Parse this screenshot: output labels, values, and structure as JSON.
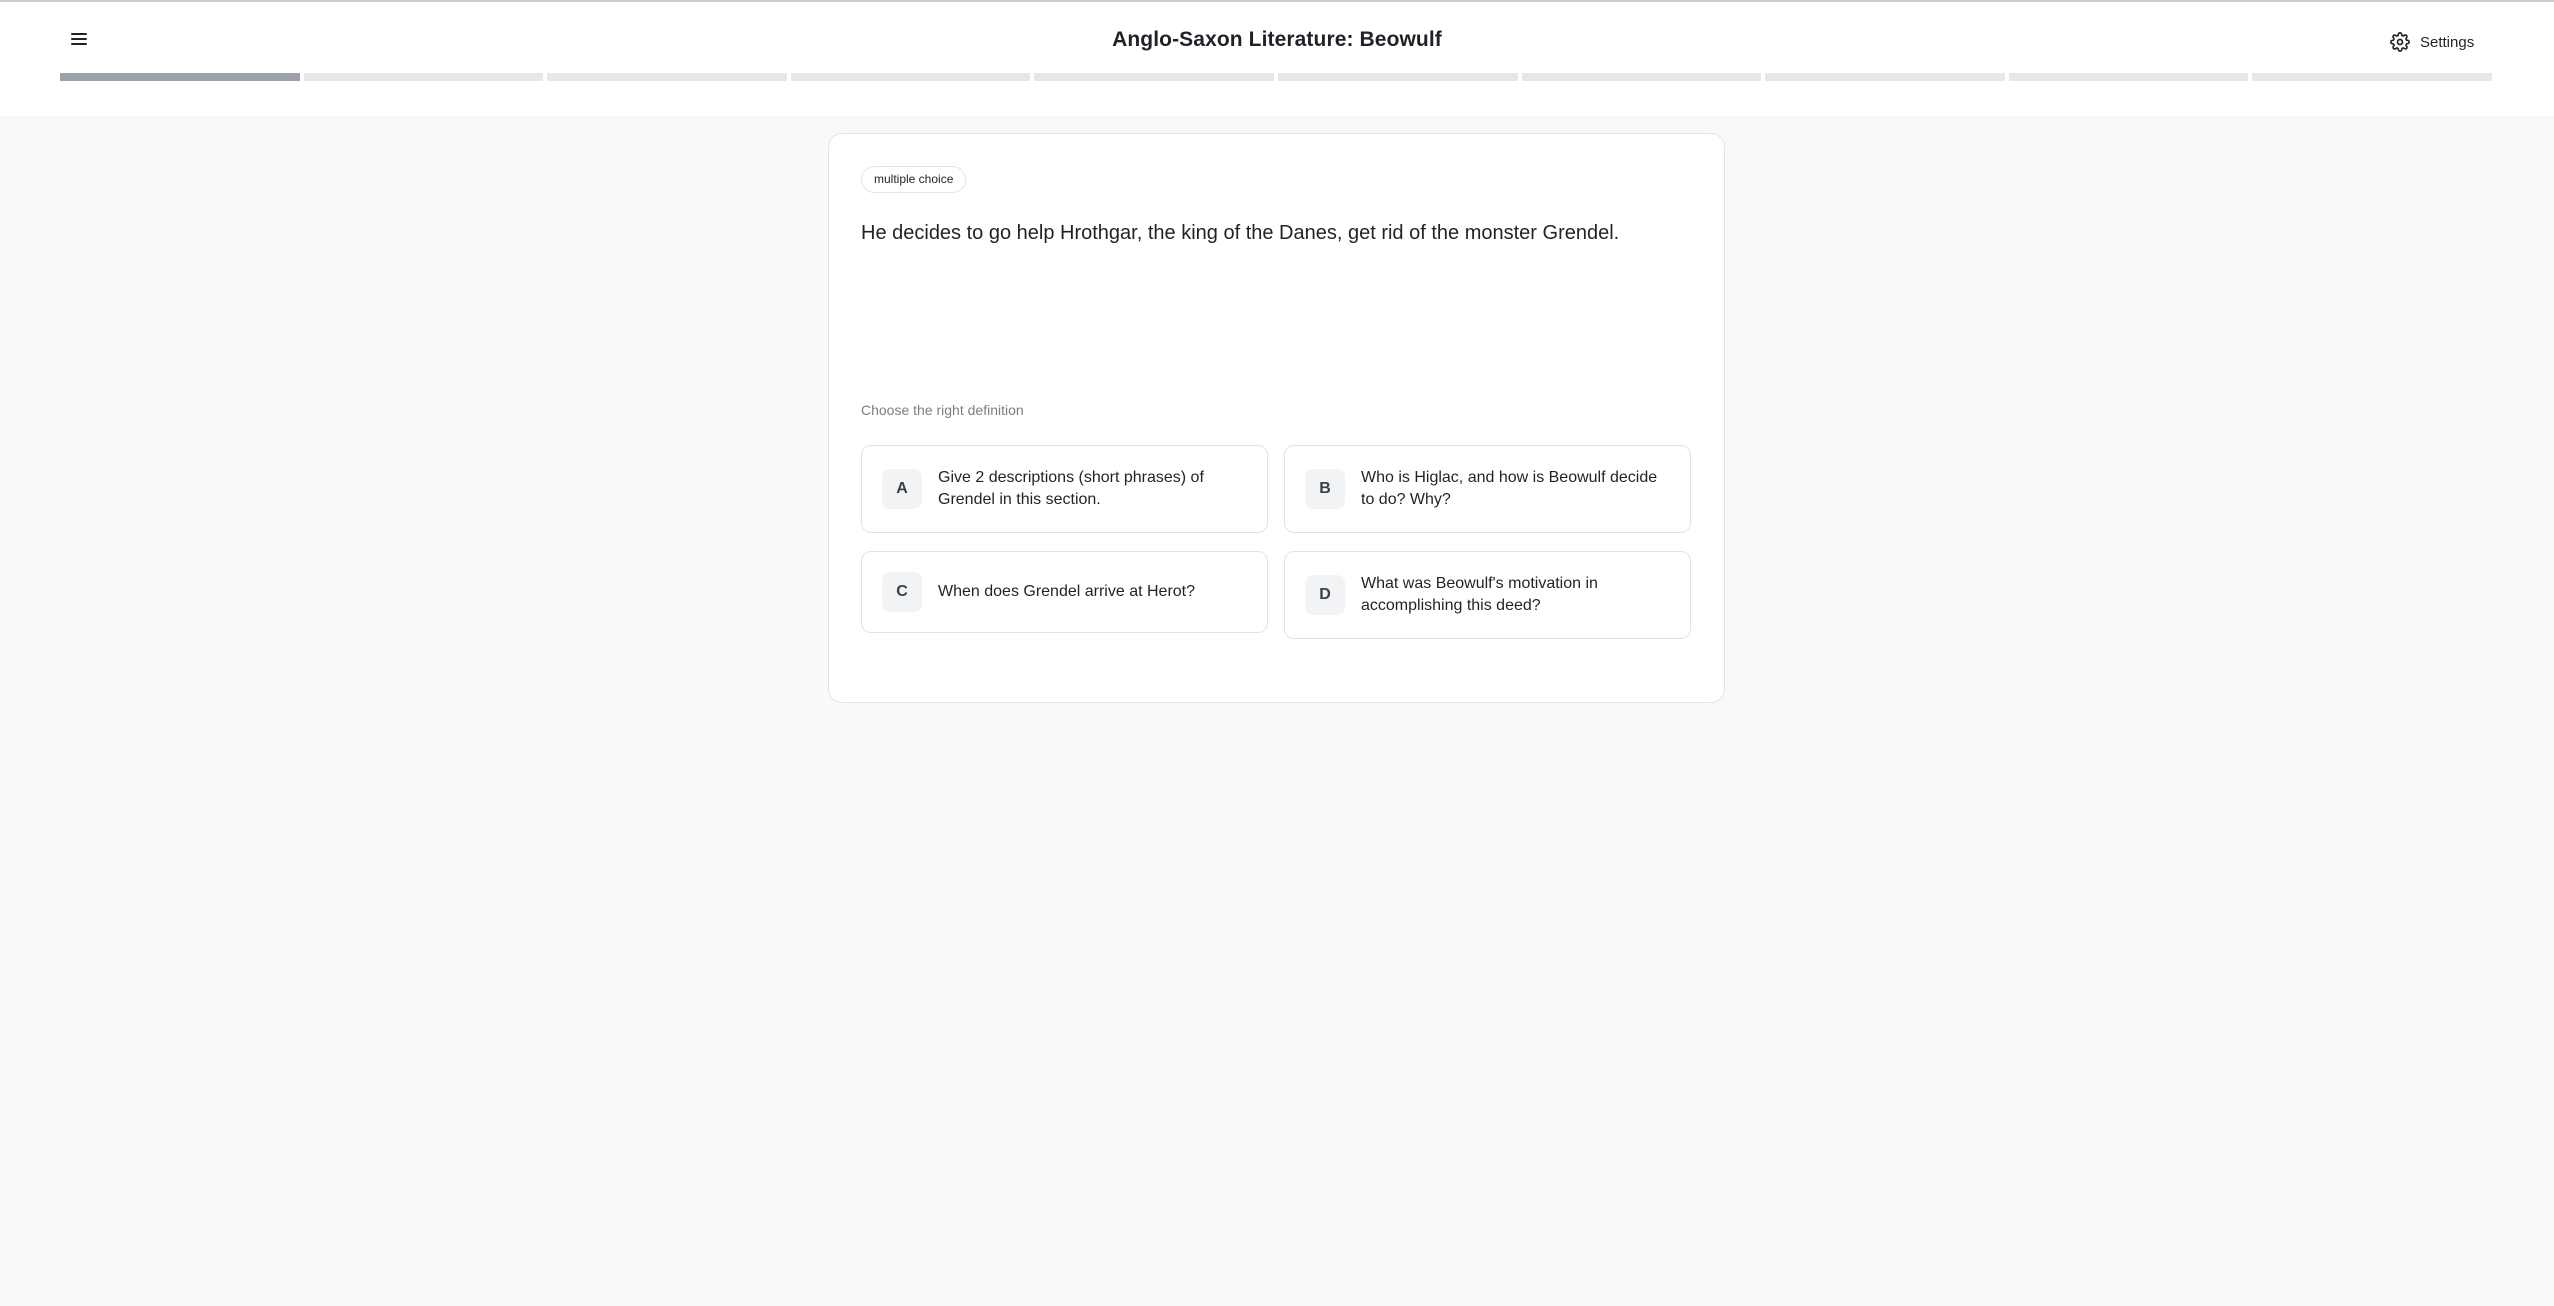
{
  "header": {
    "title": "Anglo-Saxon Literature: Beowulf",
    "settings_label": "Settings",
    "menu_icon": "hamburger-menu-icon",
    "settings_icon": "gear-icon"
  },
  "progress": {
    "total_segments": 10,
    "completed_segments": 1
  },
  "card": {
    "badge": "multiple choice",
    "question": "He decides to go help Hrothgar, the king of the Danes, get rid of the monster Grendel.",
    "prompt": "Choose the right definition",
    "options": [
      {
        "letter": "A",
        "text": "Give 2 descriptions (short phrases) of Grendel in this section."
      },
      {
        "letter": "B",
        "text": "Who is Higlac, and how is Beowulf decide to do? Why?"
      },
      {
        "letter": "C",
        "text": "When does Grendel arrive at Herot?"
      },
      {
        "letter": "D",
        "text": "What was Beowulf's motivation in accomplishing this deed?"
      }
    ]
  }
}
